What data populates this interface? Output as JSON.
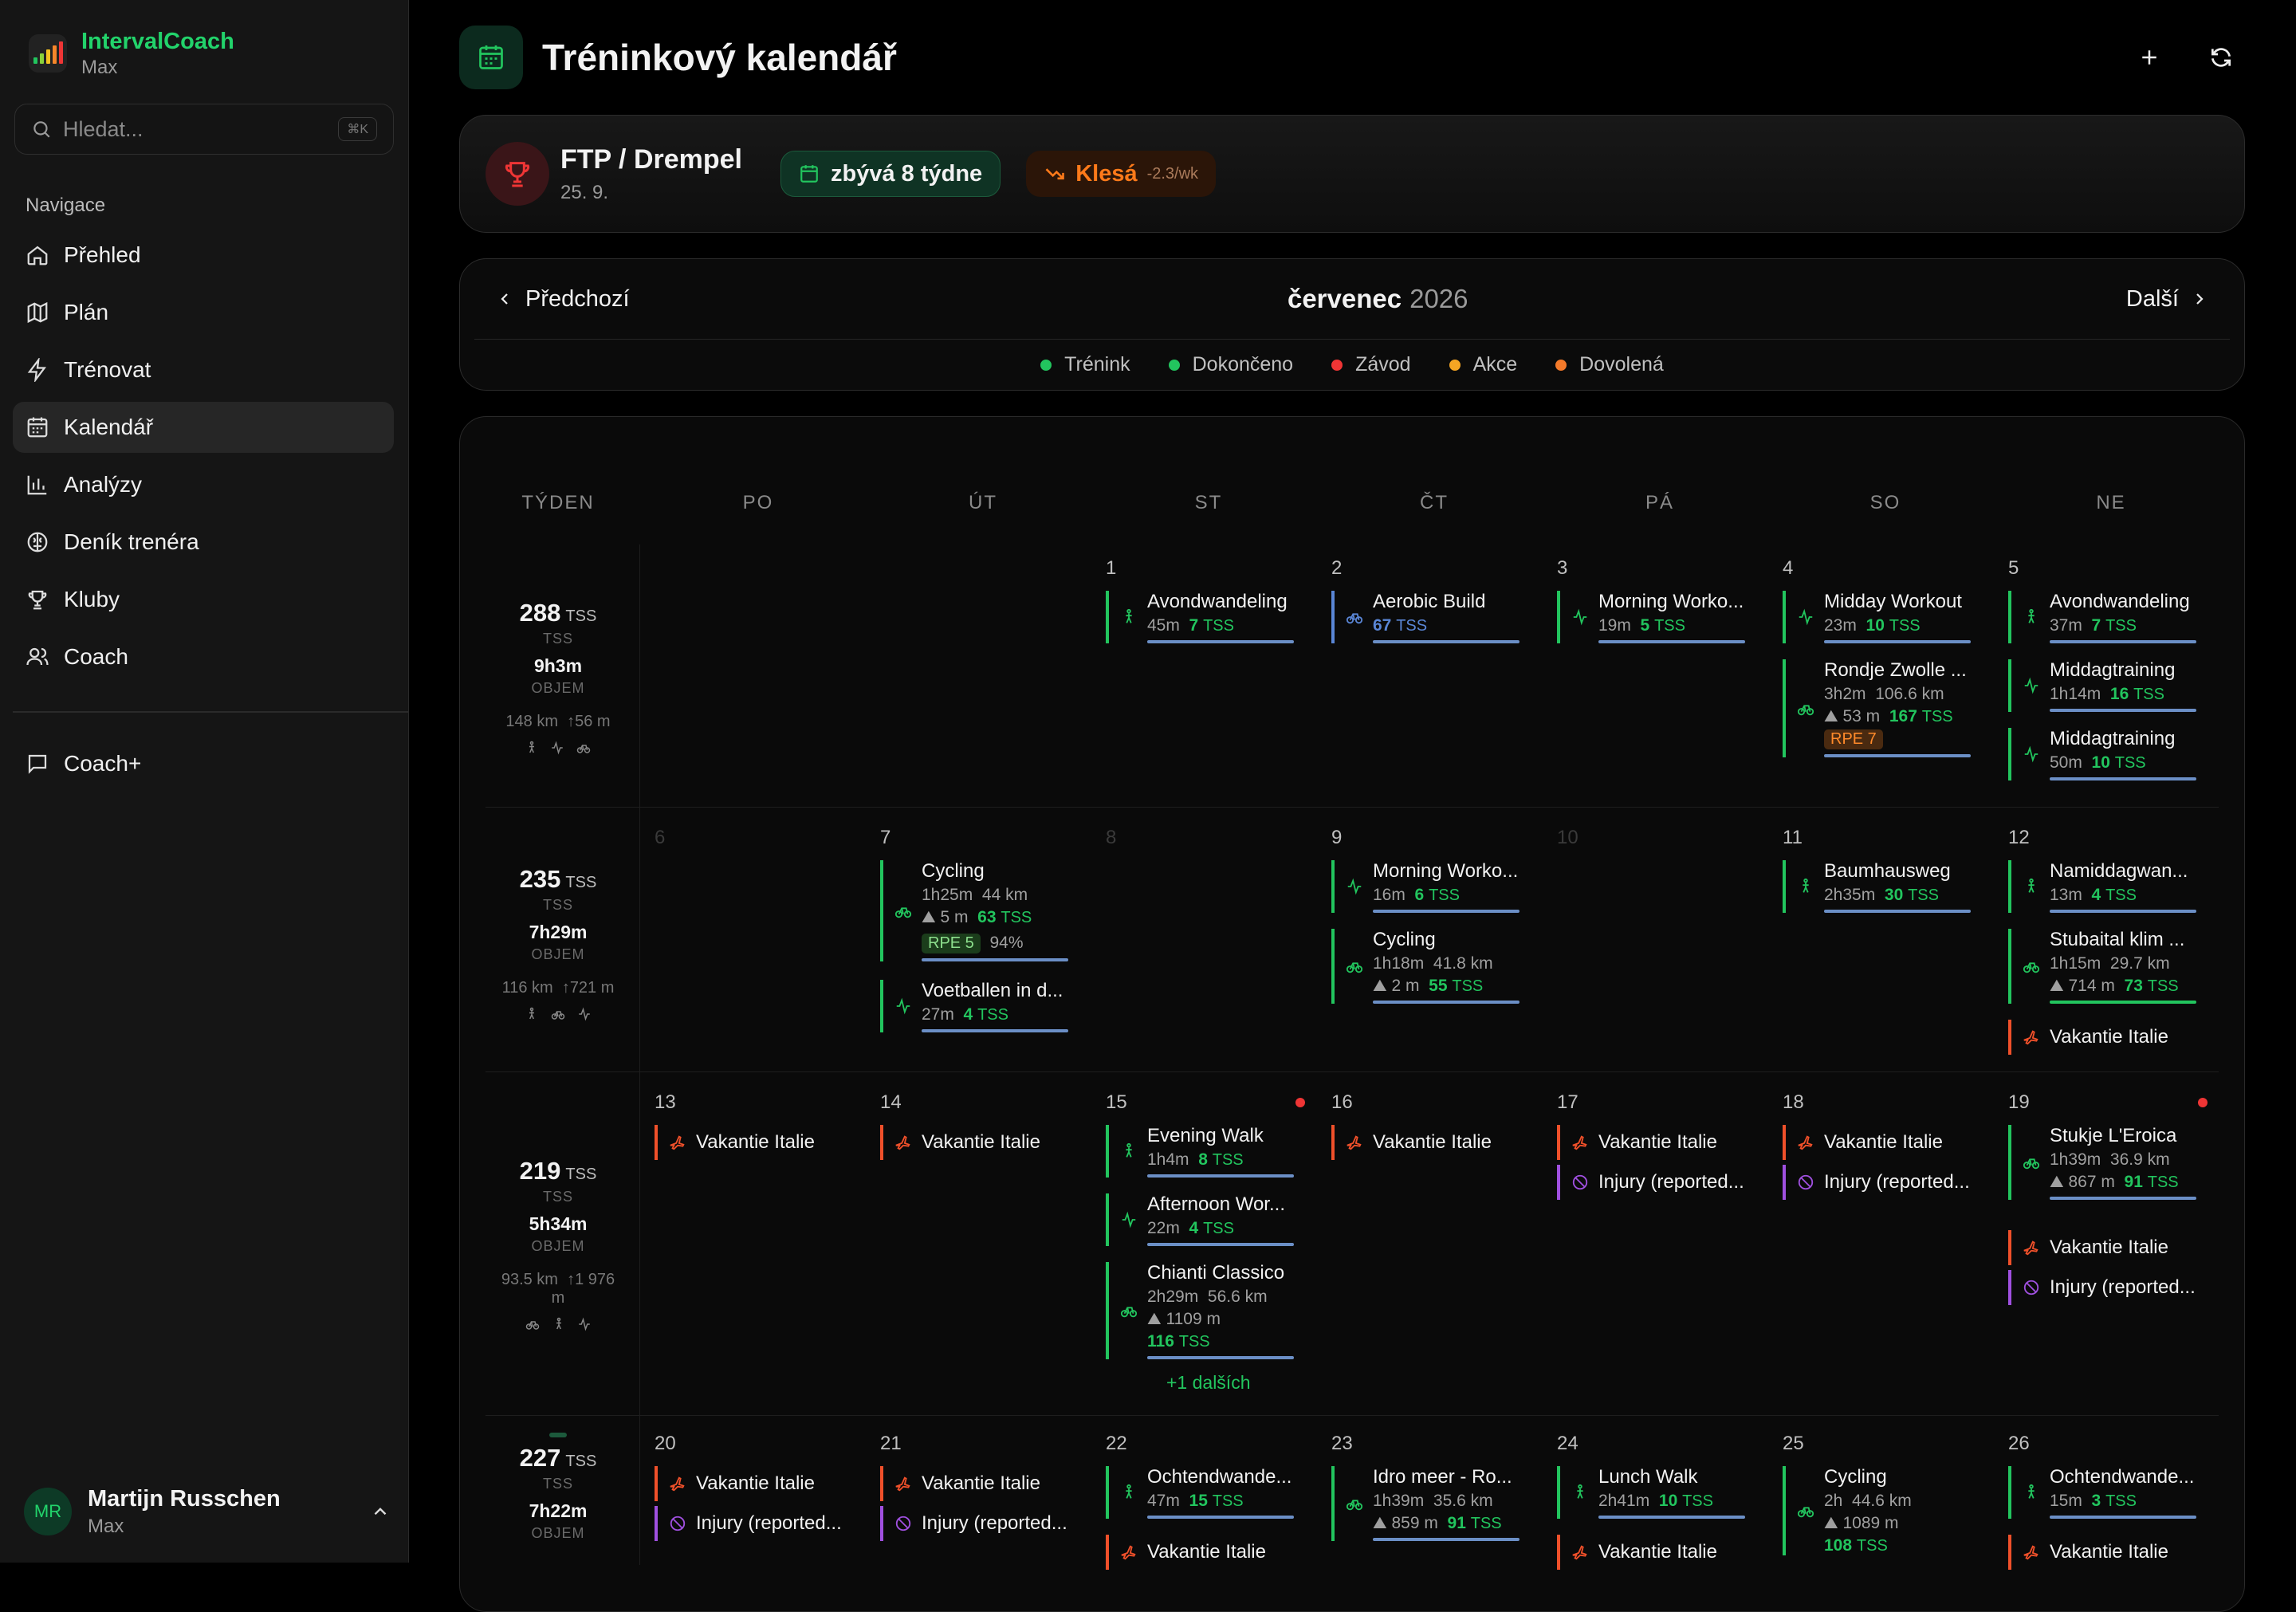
{
  "app": {
    "name": "IntervalCoach",
    "sub": "Max"
  },
  "search": {
    "placeholder": "Hledat...",
    "shortcut": "⌘K"
  },
  "nav": {
    "title": "Navigace",
    "items": [
      {
        "label": "Přehled"
      },
      {
        "label": "Plán"
      },
      {
        "label": "Trénovat"
      },
      {
        "label": "Kalendář"
      },
      {
        "label": "Analýzy"
      },
      {
        "label": "Deník trenéra"
      },
      {
        "label": "Kluby"
      },
      {
        "label": "Coach"
      }
    ],
    "coachplus": "Coach+"
  },
  "user": {
    "initials": "MR",
    "name": "Martijn Russchen",
    "sub": "Max"
  },
  "header": {
    "title": "Tréninkový kalendář"
  },
  "goal": {
    "title": "FTP / Drempel",
    "date": "25. 9.",
    "weeks": "zbývá 8 týdne",
    "trend": "Klesá",
    "trend_rate": "-2.3/wk"
  },
  "month": {
    "prev": "Předchozí",
    "next": "Další",
    "name": "červenec",
    "year": "2026"
  },
  "legend": [
    {
      "label": "Trénink",
      "color": "#22c55e"
    },
    {
      "label": "Dokončeno",
      "color": "#22c55e"
    },
    {
      "label": "Závod",
      "color": "#ef3535"
    },
    {
      "label": "Akce",
      "color": "#f5a623"
    },
    {
      "label": "Dovolená",
      "color": "#f47a2a"
    }
  ],
  "cols": [
    "TÝDEN",
    "PO",
    "ÚT",
    "ST",
    "ČT",
    "PÁ",
    "SO",
    "NE"
  ],
  "weeks": [
    {
      "tss": "288",
      "tss_unit": "TSS",
      "tss_lbl": "TSS",
      "time": "9h3m",
      "time_lbl": "OBJEM",
      "dist": "148 km",
      "elev": "↑56 m"
    },
    {
      "tss": "235",
      "tss_unit": "TSS",
      "tss_lbl": "TSS",
      "time": "7h29m",
      "time_lbl": "OBJEM",
      "dist": "116 km",
      "elev": "↑721 m"
    },
    {
      "tss": "219",
      "tss_unit": "TSS",
      "tss_lbl": "TSS",
      "time": "5h34m",
      "time_lbl": "OBJEM",
      "dist": "93.5 km",
      "elev": "↑1 976 m"
    },
    {
      "tss": "227",
      "tss_unit": "TSS",
      "tss_lbl": "TSS",
      "time": "7h22m",
      "time_lbl": "OBJEM"
    }
  ],
  "days": {
    "d1": "1",
    "d2": "2",
    "d3": "3",
    "d4": "4",
    "d5": "5",
    "d6": "6",
    "d7": "7",
    "d8": "8",
    "d9": "9",
    "d10": "10",
    "d11": "11",
    "d12": "12",
    "d13": "13",
    "d14": "14",
    "d15": "15",
    "d16": "16",
    "d17": "17",
    "d18": "18",
    "d19": "19",
    "d20": "20",
    "d21": "21",
    "d22": "22",
    "d23": "23",
    "d24": "24",
    "d25": "25",
    "d26": "26"
  },
  "events": {
    "e1": {
      "t": "Avondwandeling",
      "d": "45m",
      "tss": "7"
    },
    "e2": {
      "t": "Aerobic Build",
      "tss": "67"
    },
    "e3": {
      "t": "Morning Worko...",
      "d": "19m",
      "tss": "5"
    },
    "e4": {
      "t": "Midday Workout",
      "d": "23m",
      "tss": "10"
    },
    "e5": {
      "t": "Rondje Zwolle ...",
      "d": "3h2m",
      "km": "106.6 km",
      "elev": "53 m",
      "tss": "167",
      "rpe": "RPE 7"
    },
    "e6": {
      "t": "Avondwandeling",
      "d": "37m",
      "tss": "7"
    },
    "e7": {
      "t": "Middagtraining",
      "d": "1h14m",
      "tss": "16"
    },
    "e8": {
      "t": "Middagtraining",
      "d": "50m",
      "tss": "10"
    },
    "e9": {
      "t": "Cycling",
      "d": "1h25m",
      "km": "44 km",
      "elev": "5 m",
      "tss": "63",
      "rpe": "RPE 5",
      "pct": "94%"
    },
    "e10": {
      "t": "Voetballen in d...",
      "d": "27m",
      "tss": "4"
    },
    "e11": {
      "t": "Morning Worko...",
      "d": "16m",
      "tss": "6"
    },
    "e12": {
      "t": "Cycling",
      "d": "1h18m",
      "km": "41.8 km",
      "elev": "2 m",
      "tss": "55"
    },
    "e13": {
      "t": "Baumhausweg",
      "d": "2h35m",
      "tss": "30"
    },
    "e14": {
      "t": "Namiddagwan...",
      "d": "13m",
      "tss": "4"
    },
    "e15": {
      "t": "Stubaital klim ...",
      "d": "1h15m",
      "km": "29.7 km",
      "elev": "714 m",
      "tss": "73"
    },
    "e16": {
      "t": "Evening Walk",
      "d": "1h4m",
      "tss": "8"
    },
    "e17": {
      "t": "Afternoon Wor...",
      "d": "22m",
      "tss": "4"
    },
    "e18": {
      "t": "Chianti Classico",
      "d": "2h29m",
      "km": "56.6 km",
      "elev": "1109 m",
      "tss": "116"
    },
    "e19": {
      "t": "Stukje L'Eroica",
      "d": "1h39m",
      "km": "36.9 km",
      "elev": "867 m",
      "tss": "91"
    },
    "e20": {
      "t": "Ochtendwande...",
      "d": "47m",
      "tss": "15"
    },
    "e21": {
      "t": "Idro meer - Ro...",
      "d": "1h39m",
      "km": "35.6 km",
      "elev": "859 m",
      "tss": "91"
    },
    "e22": {
      "t": "Lunch Walk",
      "d": "2h41m",
      "tss": "10"
    },
    "e23": {
      "t": "Cycling",
      "d": "2h",
      "km": "44.6 km",
      "elev": "1089 m",
      "tss": "108"
    },
    "e24": {
      "t": "Ochtendwande...",
      "d": "15m",
      "tss": "3"
    }
  },
  "tss_unit": "TSS",
  "vacation": "Vakantie Italie",
  "injury": "Injury (reported...",
  "more": "+1 dalších"
}
